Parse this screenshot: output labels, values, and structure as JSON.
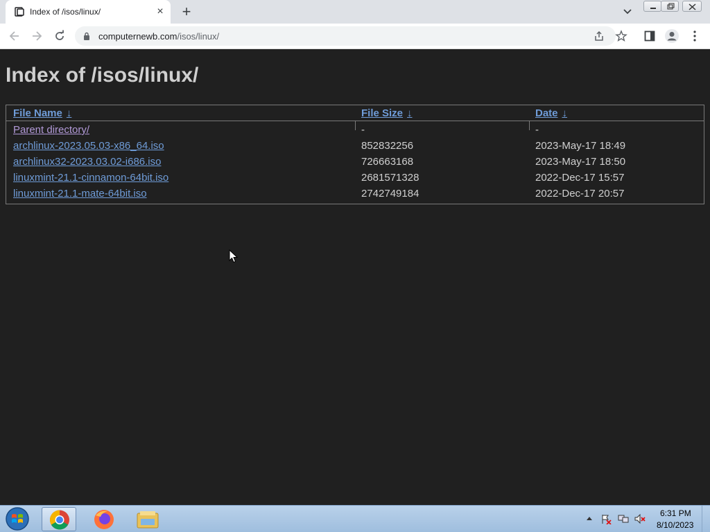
{
  "browser": {
    "tab_title": "Index of /isos/linux/",
    "url_host": "computernewb.com",
    "url_path": "/isos/linux/"
  },
  "page": {
    "heading": "Index of /isos/linux/",
    "columns": {
      "name": "File Name",
      "size": "File Size",
      "date": "Date",
      "sort_glyph": "↓"
    },
    "rows": [
      {
        "name": "Parent directory/",
        "size": "-",
        "date": "-"
      },
      {
        "name": "archlinux-2023.05.03-x86_64.iso",
        "size": "852832256",
        "date": "2023-May-17 18:49"
      },
      {
        "name": "archlinux32-2023.03.02-i686.iso",
        "size": "726663168",
        "date": "2023-May-17 18:50"
      },
      {
        "name": "linuxmint-21.1-cinnamon-64bit.iso",
        "size": "2681571328",
        "date": "2022-Dec-17 15:57"
      },
      {
        "name": "linuxmint-21.1-mate-64bit.iso",
        "size": "2742749184",
        "date": "2022-Dec-17 20:57"
      }
    ]
  },
  "taskbar": {
    "time": "6:31 PM",
    "date": "8/10/2023",
    "apps": [
      "chrome-icon",
      "firefox-icon",
      "file-explorer-icon"
    ]
  },
  "colors": {
    "page_bg": "#202020",
    "link": "#6f9cd8",
    "visited_link": "#b29ad8",
    "text": "#d0d0d0"
  }
}
